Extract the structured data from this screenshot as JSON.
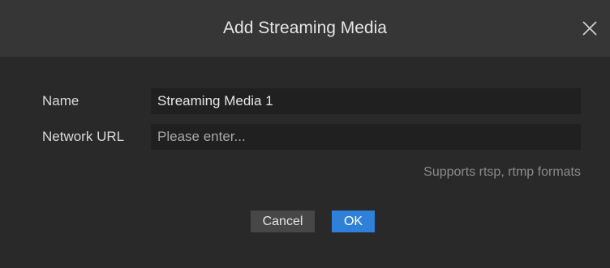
{
  "dialog": {
    "title": "Add Streaming Media",
    "close_icon": "close-icon"
  },
  "form": {
    "name_label": "Name",
    "name_value": "Streaming Media 1",
    "url_label": "Network URL",
    "url_placeholder": "Please enter...",
    "url_value": "",
    "hint": "Supports rtsp, rtmp formats"
  },
  "buttons": {
    "cancel_label": "Cancel",
    "ok_label": "OK"
  },
  "colors": {
    "accent": "#2f80d8",
    "background": "#292929",
    "titlebar": "#363636",
    "input_background": "#202020"
  }
}
